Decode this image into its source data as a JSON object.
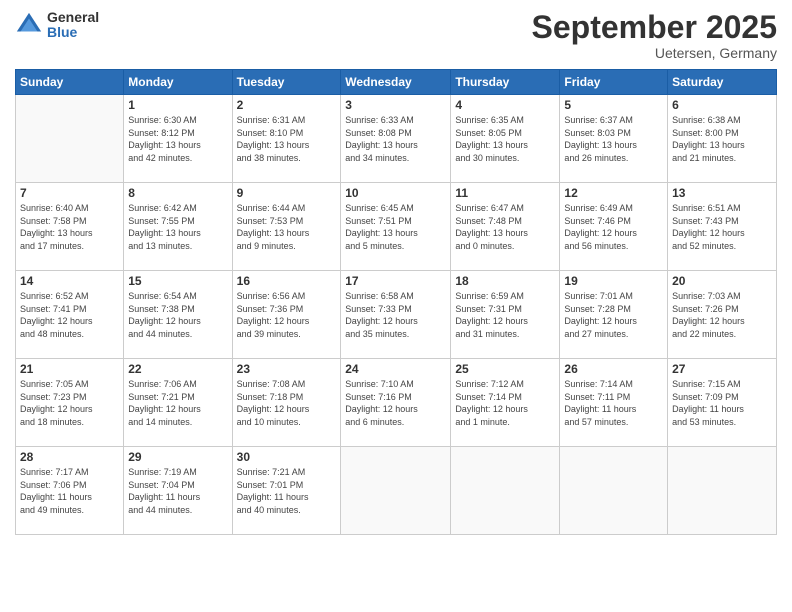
{
  "logo": {
    "general": "General",
    "blue": "Blue"
  },
  "title": "September 2025",
  "location": "Uetersen, Germany",
  "weekdays": [
    "Sunday",
    "Monday",
    "Tuesday",
    "Wednesday",
    "Thursday",
    "Friday",
    "Saturday"
  ],
  "weeks": [
    [
      {
        "day": "",
        "info": ""
      },
      {
        "day": "1",
        "info": "Sunrise: 6:30 AM\nSunset: 8:12 PM\nDaylight: 13 hours\nand 42 minutes."
      },
      {
        "day": "2",
        "info": "Sunrise: 6:31 AM\nSunset: 8:10 PM\nDaylight: 13 hours\nand 38 minutes."
      },
      {
        "day": "3",
        "info": "Sunrise: 6:33 AM\nSunset: 8:08 PM\nDaylight: 13 hours\nand 34 minutes."
      },
      {
        "day": "4",
        "info": "Sunrise: 6:35 AM\nSunset: 8:05 PM\nDaylight: 13 hours\nand 30 minutes."
      },
      {
        "day": "5",
        "info": "Sunrise: 6:37 AM\nSunset: 8:03 PM\nDaylight: 13 hours\nand 26 minutes."
      },
      {
        "day": "6",
        "info": "Sunrise: 6:38 AM\nSunset: 8:00 PM\nDaylight: 13 hours\nand 21 minutes."
      }
    ],
    [
      {
        "day": "7",
        "info": "Sunrise: 6:40 AM\nSunset: 7:58 PM\nDaylight: 13 hours\nand 17 minutes."
      },
      {
        "day": "8",
        "info": "Sunrise: 6:42 AM\nSunset: 7:55 PM\nDaylight: 13 hours\nand 13 minutes."
      },
      {
        "day": "9",
        "info": "Sunrise: 6:44 AM\nSunset: 7:53 PM\nDaylight: 13 hours\nand 9 minutes."
      },
      {
        "day": "10",
        "info": "Sunrise: 6:45 AM\nSunset: 7:51 PM\nDaylight: 13 hours\nand 5 minutes."
      },
      {
        "day": "11",
        "info": "Sunrise: 6:47 AM\nSunset: 7:48 PM\nDaylight: 13 hours\nand 0 minutes."
      },
      {
        "day": "12",
        "info": "Sunrise: 6:49 AM\nSunset: 7:46 PM\nDaylight: 12 hours\nand 56 minutes."
      },
      {
        "day": "13",
        "info": "Sunrise: 6:51 AM\nSunset: 7:43 PM\nDaylight: 12 hours\nand 52 minutes."
      }
    ],
    [
      {
        "day": "14",
        "info": "Sunrise: 6:52 AM\nSunset: 7:41 PM\nDaylight: 12 hours\nand 48 minutes."
      },
      {
        "day": "15",
        "info": "Sunrise: 6:54 AM\nSunset: 7:38 PM\nDaylight: 12 hours\nand 44 minutes."
      },
      {
        "day": "16",
        "info": "Sunrise: 6:56 AM\nSunset: 7:36 PM\nDaylight: 12 hours\nand 39 minutes."
      },
      {
        "day": "17",
        "info": "Sunrise: 6:58 AM\nSunset: 7:33 PM\nDaylight: 12 hours\nand 35 minutes."
      },
      {
        "day": "18",
        "info": "Sunrise: 6:59 AM\nSunset: 7:31 PM\nDaylight: 12 hours\nand 31 minutes."
      },
      {
        "day": "19",
        "info": "Sunrise: 7:01 AM\nSunset: 7:28 PM\nDaylight: 12 hours\nand 27 minutes."
      },
      {
        "day": "20",
        "info": "Sunrise: 7:03 AM\nSunset: 7:26 PM\nDaylight: 12 hours\nand 22 minutes."
      }
    ],
    [
      {
        "day": "21",
        "info": "Sunrise: 7:05 AM\nSunset: 7:23 PM\nDaylight: 12 hours\nand 18 minutes."
      },
      {
        "day": "22",
        "info": "Sunrise: 7:06 AM\nSunset: 7:21 PM\nDaylight: 12 hours\nand 14 minutes."
      },
      {
        "day": "23",
        "info": "Sunrise: 7:08 AM\nSunset: 7:18 PM\nDaylight: 12 hours\nand 10 minutes."
      },
      {
        "day": "24",
        "info": "Sunrise: 7:10 AM\nSunset: 7:16 PM\nDaylight: 12 hours\nand 6 minutes."
      },
      {
        "day": "25",
        "info": "Sunrise: 7:12 AM\nSunset: 7:14 PM\nDaylight: 12 hours\nand 1 minute."
      },
      {
        "day": "26",
        "info": "Sunrise: 7:14 AM\nSunset: 7:11 PM\nDaylight: 11 hours\nand 57 minutes."
      },
      {
        "day": "27",
        "info": "Sunrise: 7:15 AM\nSunset: 7:09 PM\nDaylight: 11 hours\nand 53 minutes."
      }
    ],
    [
      {
        "day": "28",
        "info": "Sunrise: 7:17 AM\nSunset: 7:06 PM\nDaylight: 11 hours\nand 49 minutes."
      },
      {
        "day": "29",
        "info": "Sunrise: 7:19 AM\nSunset: 7:04 PM\nDaylight: 11 hours\nand 44 minutes."
      },
      {
        "day": "30",
        "info": "Sunrise: 7:21 AM\nSunset: 7:01 PM\nDaylight: 11 hours\nand 40 minutes."
      },
      {
        "day": "",
        "info": ""
      },
      {
        "day": "",
        "info": ""
      },
      {
        "day": "",
        "info": ""
      },
      {
        "day": "",
        "info": ""
      }
    ]
  ]
}
